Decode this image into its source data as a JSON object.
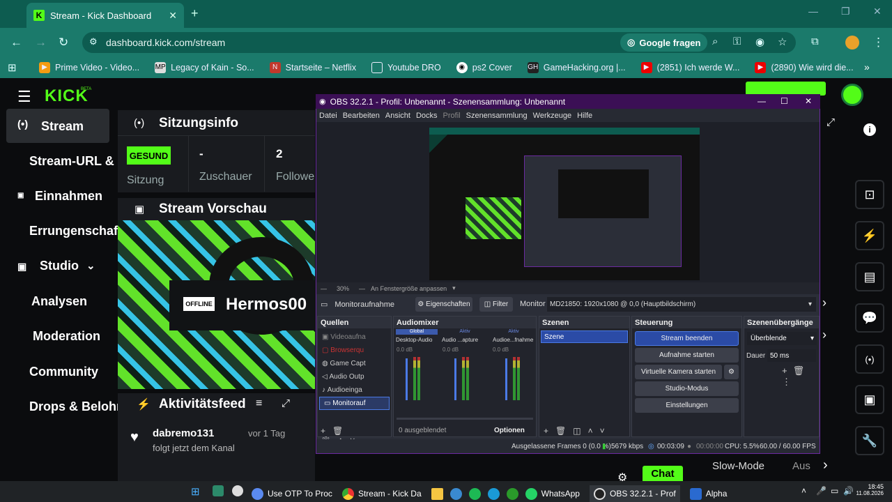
{
  "browser": {
    "tab_title": "Stream - Kick Dashboard",
    "url": "dashboard.kick.com/stream",
    "google_btn": "Google fragen",
    "bookmarks": [
      "Prime Video - Video...",
      "Legacy of Kain - So...",
      "Startseite – Netflix",
      "Youtube DRO",
      "ps2 Cover",
      "GameHacking.org |...",
      "(2851) Ich werde W...",
      "(2890) Wie wird die..."
    ]
  },
  "kick": {
    "logo": "KICK",
    "beta": "BETA",
    "nav": [
      "Stream",
      "Stream-URL & -",
      "Einnahmen",
      "Errungenschaft",
      "Studio",
      "Analysen",
      "Moderation",
      "Community",
      "Drops & Belohn"
    ],
    "session_title": "Sitzungsinfo",
    "status_badge": "GESUND",
    "status_label": "Sitzung",
    "viewers_value": "-",
    "viewers_label": "Zuschauer",
    "followers_value": "2",
    "followers_label": "Follower",
    "preview_title": "Stream Vorschau",
    "offline_badge": "OFFLINE",
    "channel_name": "Hermos00",
    "activity_title": "Aktivitätsfeed",
    "activity_user": "dabremo131",
    "activity_time": "vor 1 Tag",
    "activity_text": "folgt jetzt dem Kanal",
    "slow_mode_label": "Slow-Mode",
    "slow_mode_value": "Aus",
    "chat_btn": "Chat"
  },
  "obs": {
    "title": "OBS 32.2.1 - Profil: Unbenannt - Szenensammlung: Unbenannt",
    "menu": [
      "Datei",
      "Bearbeiten",
      "Ansicht",
      "Docks",
      "Profil",
      "Szenensammlung",
      "Werkzeuge",
      "Hilfe"
    ],
    "zoom": "30%",
    "fit": "An Fenstergröße anpassen",
    "source_label": "Monitoraufnahme",
    "props_btn": "Eigenschaften",
    "filter_btn": "Filter",
    "monitor_label": "Monitor",
    "monitor_value": "MD21850: 1920x1080 @ 0,0 (Hauptbildschirm)",
    "sources_title": "Quellen",
    "sources": [
      "Videoaufna",
      "Browserqu",
      "Game Capt",
      "Audio Outp",
      "Audioeinga",
      "Monitorauf"
    ],
    "mixer_title": "Audiomixer",
    "mixer_tags": [
      "Global",
      "Aktiv",
      "Aktiv"
    ],
    "mixer_channels": [
      "Desktop-Audio",
      "Audio ...apture",
      "Audioe...fnahme"
    ],
    "mixer_db": "0.0 dB",
    "mixer_hidden": "0 ausgeblendet",
    "mixer_options": "Optionen",
    "scenes_title": "Szenen",
    "scene": "Szene",
    "controls_title": "Steuerung",
    "controls": [
      "Stream beenden",
      "Aufnahme starten",
      "Virtuelle Kamera starten",
      "Studio-Modus",
      "Einstellungen"
    ],
    "trans_title": "Szenenübergänge",
    "trans_value": "Überblende",
    "duration_label": "Dauer",
    "duration_value": "50 ms",
    "status_frames": "Ausgelassene Frames 0 (0.0 %)",
    "status_kbps": "5679 kbps",
    "status_time": "00:03:09",
    "status_rec": "00:00:00",
    "status_cpu": "CPU: 5.5%",
    "status_fps": "60.00 / 60.00 FPS"
  },
  "taskbar": {
    "items": [
      "Use OTP To Proc",
      "Stream - Kick Da",
      "WhatsApp",
      "OBS 32.2.1 - Prof",
      "Alpha"
    ],
    "time": "18:45",
    "date": "11.08.2026"
  }
}
